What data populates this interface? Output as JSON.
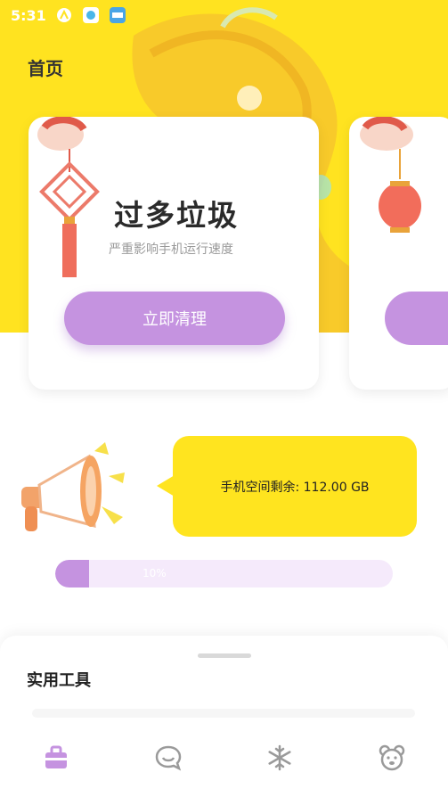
{
  "status_bar": {
    "time": "5:31"
  },
  "header": {
    "title": "首页"
  },
  "card": {
    "title": "过多垃圾",
    "subtitle": "严重影响手机运行速度",
    "button_label": "立即清理"
  },
  "storage": {
    "label": "手机空间剩余: 112.00 GB",
    "progress_label": "10%",
    "progress_fraction": 0.1
  },
  "tools": {
    "title": "实用工具"
  },
  "bottom_nav": {
    "items": [
      {
        "icon": "toolbox-icon",
        "active": true
      },
      {
        "icon": "chat-bubble-icon",
        "active": false
      },
      {
        "icon": "snowflake-icon",
        "active": false
      },
      {
        "icon": "bear-face-icon",
        "active": false
      }
    ]
  },
  "colors": {
    "accent_yellow": "#ffe320",
    "accent_purple": "#c593e0",
    "progress_track": "#f5eafb"
  }
}
